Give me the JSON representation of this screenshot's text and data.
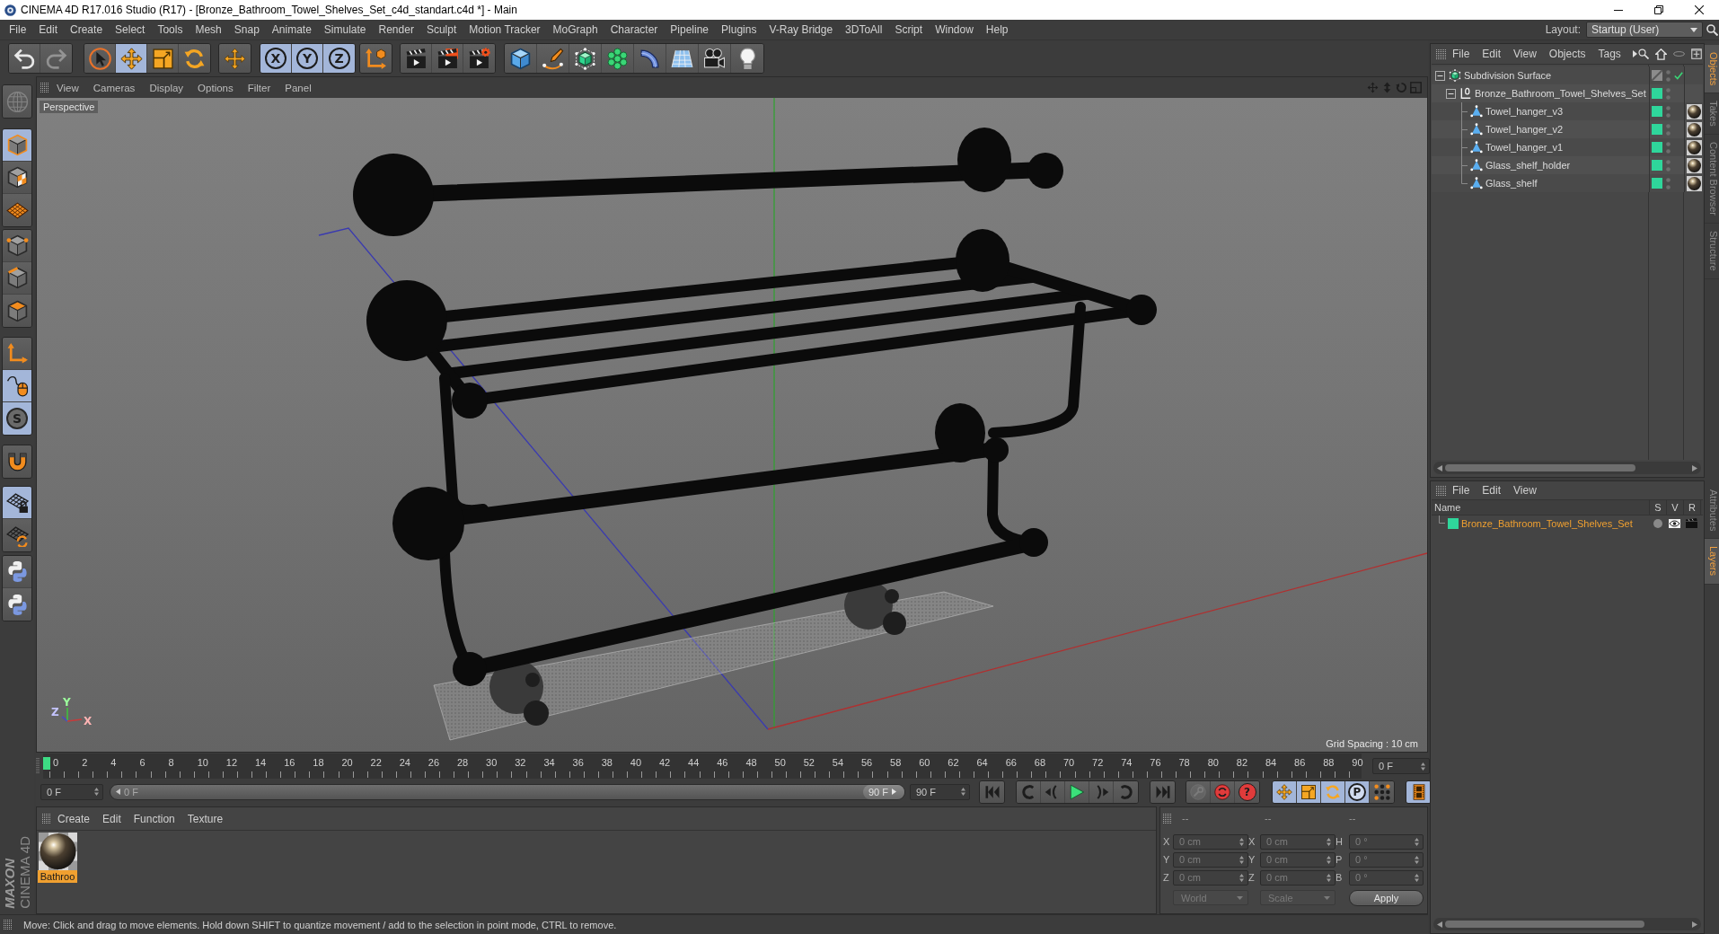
{
  "window": {
    "title": "CINEMA 4D R17.016 Studio (R17) - [Bronze_Bathroom_Towel_Shelves_Set_c4d_standart.c4d *] - Main"
  },
  "menu": [
    "File",
    "Edit",
    "Create",
    "Select",
    "Tools",
    "Mesh",
    "Snap",
    "Animate",
    "Simulate",
    "Render",
    "Sculpt",
    "Motion Tracker",
    "MoGraph",
    "Character",
    "Pipeline",
    "Plugins",
    "V-Ray Bridge",
    "3DToAll",
    "Script",
    "Window",
    "Help"
  ],
  "layout": {
    "label": "Layout:",
    "value": "Startup (User)"
  },
  "toolbar": [
    [
      {
        "kind": "undo",
        "disabled": false
      },
      {
        "kind": "redo",
        "disabled": true
      }
    ],
    [
      {
        "kind": "select",
        "selected": false
      },
      {
        "kind": "move",
        "selected": true
      },
      {
        "kind": "scale",
        "selected": false
      },
      {
        "kind": "rotate",
        "selected": false
      }
    ],
    [
      {
        "kind": "transform",
        "selected": false
      }
    ],
    [
      {
        "kind": "lock",
        "label": "X",
        "on": true
      },
      {
        "kind": "lock",
        "label": "Y",
        "on": true
      },
      {
        "kind": "lock",
        "label": "Z",
        "on": true
      }
    ],
    [
      {
        "kind": "coordsystem"
      }
    ],
    [
      {
        "kind": "render"
      },
      {
        "kind": "renderview"
      },
      {
        "kind": "rendersettings"
      }
    ],
    [
      {
        "kind": "cube"
      },
      {
        "kind": "pen"
      },
      {
        "kind": "subdivision"
      },
      {
        "kind": "cloner"
      },
      {
        "kind": "bend"
      },
      {
        "kind": "floor"
      },
      {
        "kind": "camera"
      },
      {
        "kind": "light"
      }
    ]
  ],
  "modes": [
    [
      {
        "kind": "globe",
        "disabled": true
      }
    ],
    [
      {
        "kind": "model",
        "selected": true
      },
      {
        "kind": "texture",
        "selected": false
      },
      {
        "kind": "workplane",
        "selected": false
      }
    ],
    [
      {
        "kind": "points",
        "selected": false
      },
      {
        "kind": "edges",
        "selected": false
      },
      {
        "kind": "polygons",
        "selected": false
      }
    ],
    [
      {
        "kind": "axes",
        "on": false
      },
      {
        "kind": "tweak",
        "on": true
      },
      {
        "kind": "solo",
        "label": "S",
        "on": true
      }
    ],
    [
      {
        "kind": "snap",
        "on": false
      }
    ],
    [
      {
        "kind": "gridlock",
        "on": true
      },
      {
        "kind": "gridrefresh",
        "on": false
      }
    ],
    [
      {
        "kind": "python"
      },
      {
        "kind": "python"
      }
    ]
  ],
  "viewport": {
    "menu": [
      "View",
      "Cameras",
      "Display",
      "Options",
      "Filter",
      "Panel"
    ],
    "camera": "Perspective",
    "grid_spacing": "Grid Spacing : 10 cm",
    "gizmo": {
      "y": "Y",
      "z": "Z",
      "x": "X"
    }
  },
  "timeline": {
    "level": 0,
    "ticks": [
      "0",
      "2",
      "4",
      "6",
      "8",
      "10",
      "12",
      "14",
      "16",
      "18",
      "20",
      "22",
      "24",
      "26",
      "28",
      "30",
      "32",
      "34",
      "36",
      "38",
      "40",
      "42",
      "44",
      "46",
      "48",
      "50",
      "52",
      "54",
      "56",
      "58",
      "60",
      "62",
      "64",
      "66",
      "68",
      "70",
      "72",
      "74",
      "76",
      "78",
      "80",
      "82",
      "84",
      "86",
      "88",
      "90"
    ],
    "frame": "0 F"
  },
  "frames": {
    "start": "0 F",
    "range_start": "0 F",
    "range_end": "90 F",
    "end": "90 F",
    "level": 1
  },
  "playback": [
    [
      {
        "kind": "start"
      }
    ],
    [
      {
        "kind": "prevkey"
      },
      {
        "kind": "prevframe"
      },
      {
        "kind": "play"
      },
      {
        "kind": "nextframe"
      },
      {
        "kind": "nextkey"
      }
    ],
    [
      {
        "kind": "end"
      }
    ],
    [
      {
        "kind": "keylock",
        "disabled": true
      },
      {
        "kind": "record",
        "disabled": false
      },
      {
        "kind": "keysel",
        "label": "?",
        "disabled": false
      }
    ],
    [
      {
        "kind": "keymove",
        "on": true
      },
      {
        "kind": "keyscale",
        "on": true
      },
      {
        "kind": "keyrotate",
        "on": true
      },
      {
        "kind": "param",
        "label": "P",
        "on": true
      },
      {
        "kind": "pla",
        "on": false
      }
    ],
    [
      {
        "kind": "film",
        "on": true
      }
    ]
  ],
  "materials": {
    "menu": [
      "Create",
      "Edit",
      "Function",
      "Texture"
    ],
    "items": [
      {
        "name": "Bathroo",
        "selected": true
      }
    ]
  },
  "coordinates": {
    "headers": [
      "--",
      "--",
      "--"
    ],
    "rows": [
      [
        {
          "axis": "X",
          "value": "0 cm"
        },
        {
          "axis": "X",
          "value": "0 cm"
        },
        {
          "axis": "H",
          "value": "0 °"
        }
      ],
      [
        {
          "axis": "Y",
          "value": "0 cm"
        },
        {
          "axis": "Y",
          "value": "0 cm"
        },
        {
          "axis": "P",
          "value": "0 °"
        }
      ],
      [
        {
          "axis": "Z",
          "value": "0 cm"
        },
        {
          "axis": "Z",
          "value": "0 cm"
        },
        {
          "axis": "B",
          "value": "0 °"
        }
      ]
    ],
    "dropdowns": [
      {
        "value": "World",
        "disabled": true
      },
      {
        "value": "Scale",
        "disabled": true
      }
    ],
    "apply": "Apply"
  },
  "logo": {
    "brand": "MAXON",
    "product": "CINEMA 4D"
  },
  "status_bar": "Move: Click and drag to move elements. Hold down SHIFT to quantize movement / add to the selection in point mode, CTRL to remove.",
  "objects": {
    "menu": [
      "File",
      "Edit",
      "View",
      "Objects",
      "Tags"
    ],
    "tree": [
      {
        "name": "Subdivision Surface",
        "kind": "subdivision",
        "expanded": true,
        "enabled": true,
        "children": [
          {
            "name": "Bronze_Bathroom_Towel_Shelves_Set",
            "kind": "null",
            "color": "#2fd69b",
            "expanded": true,
            "children": [
              {
                "name": "Towel_hanger_v3",
                "kind": "polygon",
                "color": "#2fd69b",
                "material_tag": true
              },
              {
                "name": "Towel_hanger_v2",
                "kind": "polygon",
                "color": "#2fd69b",
                "material_tag": true
              },
              {
                "name": "Towel_hanger_v1",
                "kind": "polygon",
                "color": "#2fd69b",
                "material_tag": true
              },
              {
                "name": "Glass_shelf_holder",
                "kind": "polygon",
                "color": "#2fd69b",
                "material_tag": true
              },
              {
                "name": "Glass_shelf",
                "kind": "polygon",
                "color": "#2fd69b",
                "material_tag": true
              }
            ]
          }
        ]
      }
    ]
  },
  "layers": {
    "menu": [
      "File",
      "Edit",
      "View"
    ],
    "columns": [
      "Name",
      "S",
      "V",
      "R"
    ],
    "rows": [
      {
        "name": "Bronze_Bathroom_Towel_Shelves_Set",
        "color": "#2fd69b",
        "selected": true,
        "solo": false,
        "visible": true,
        "render": true
      }
    ]
  },
  "side_tabs": {
    "upper": [
      {
        "label": "Objects",
        "selected": true
      },
      {
        "label": "Takes",
        "selected": false
      },
      {
        "label": "Content Browser",
        "selected": false
      },
      {
        "label": "Structure",
        "selected": false
      }
    ],
    "lower": [
      {
        "label": "Attributes",
        "selected": false
      },
      {
        "label": "Layers",
        "selected": true
      }
    ]
  }
}
